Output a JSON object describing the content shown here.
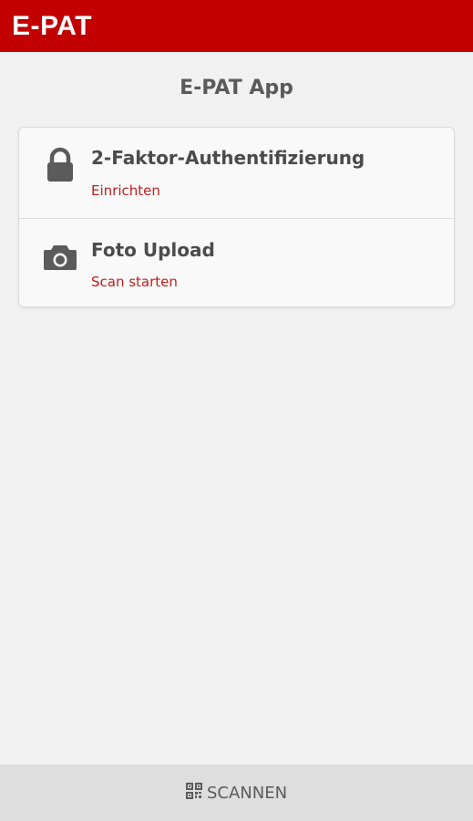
{
  "header": {
    "brand": "E-PAT"
  },
  "page": {
    "title": "E-PAT App"
  },
  "items": [
    {
      "title": "2-Faktor-Authentifizierung",
      "action": "Einrichten",
      "icon": "lock-icon"
    },
    {
      "title": "Foto Upload",
      "action": "Scan starten",
      "icon": "camera-icon"
    }
  ],
  "footer": {
    "scan_label": "SCANNEN",
    "icon": "qr-code-icon"
  },
  "colors": {
    "brand_red": "#c20000",
    "action_red": "#c21d1d",
    "text_gray": "#4b4b4b",
    "bg": "#f1f1f1"
  }
}
